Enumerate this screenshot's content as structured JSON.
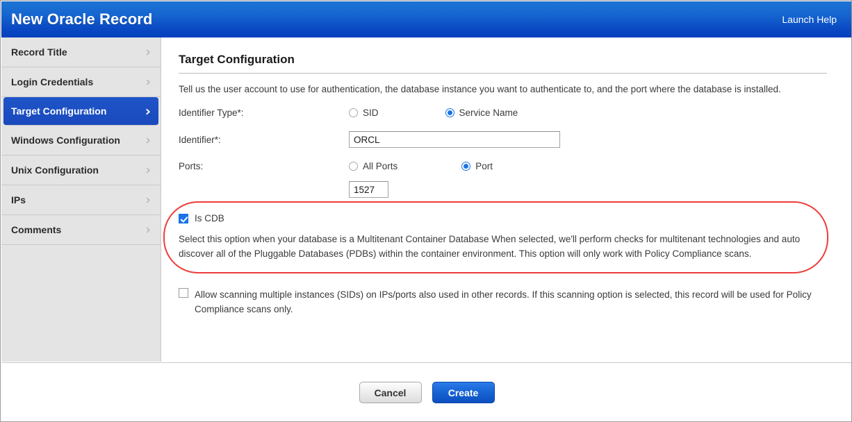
{
  "window": {
    "title": "New Oracle Record",
    "help_link": "Launch Help"
  },
  "sidebar": {
    "items": [
      {
        "label": "Record Title",
        "active": false
      },
      {
        "label": "Login Credentials",
        "active": false
      },
      {
        "label": "Target Configuration",
        "active": true
      },
      {
        "label": "Windows Configuration",
        "active": false
      },
      {
        "label": "Unix Configuration",
        "active": false
      },
      {
        "label": "IPs",
        "active": false
      },
      {
        "label": "Comments",
        "active": false
      }
    ],
    "chevron": "›"
  },
  "main": {
    "section_title": "Target Configuration",
    "section_desc": "Tell us the user account to use for authentication, the database instance you want to authenticate to, and the port where the database is installed.",
    "identifier_type": {
      "label": "Identifier Type*:",
      "options": [
        {
          "label": "SID",
          "selected": false
        },
        {
          "label": "Service Name",
          "selected": true
        }
      ]
    },
    "identifier": {
      "label": "Identifier*:",
      "value": "ORCL",
      "placeholder": ""
    },
    "ports": {
      "label": "Ports:",
      "options": [
        {
          "label": "All Ports",
          "selected": false
        },
        {
          "label": "Port",
          "selected": true
        }
      ],
      "port_value": "1527",
      "port_placeholder": ""
    },
    "is_cdb": {
      "label": "Is CDB",
      "checked": true,
      "description": "Select this option when your database is a Multitenant Container Database When selected, we'll perform checks for multitenant technologies and auto discover all of the Pluggable Databases (PDBs) within the container environment. This option will only work with Policy Compliance scans."
    },
    "allow_multiple": {
      "checked": false,
      "description": "Allow scanning multiple instances (SIDs) on IPs/ports also used in other records. If this scanning option is selected, this record will be used for Policy Compliance scans only."
    }
  },
  "footer": {
    "cancel_label": "Cancel",
    "create_label": "Create"
  },
  "colors": {
    "header_blue": "#0b4bc4",
    "accent_blue": "#1a73e8",
    "active_nav": "#1a49bd",
    "annotation_red": "#ee3b3b",
    "sidebar_bg": "#e4e4e4"
  }
}
